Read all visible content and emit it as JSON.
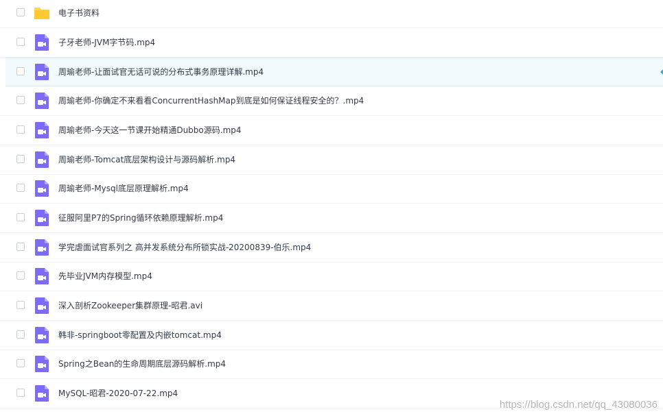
{
  "colors": {
    "folder": "#ffd45a",
    "video_icon": "#7b6cf3",
    "text": "#333a44",
    "highlight_bg": "#f2fafd"
  },
  "files": [
    {
      "name": "电子书资料",
      "icon": "folder-icon"
    },
    {
      "name": "子牙老师-JVM字节码.mp4",
      "icon": "video-file-icon"
    },
    {
      "name": "周瑜老师-让面试官无话可说的分布式事务原理详解.mp4",
      "icon": "video-file-icon",
      "highlighted": true
    },
    {
      "name": "周瑜老师-你确定不来看看ConcurrentHashMap到底是如何保证线程安全的？.mp4",
      "icon": "video-file-icon"
    },
    {
      "name": "周瑜老师-今天这一节课开始精通Dubbo源码.mp4",
      "icon": "video-file-icon"
    },
    {
      "name": "周瑜老师-Tomcat底层架构设计与源码解析.mp4",
      "icon": "video-file-icon"
    },
    {
      "name": "周瑜老师-Mysql底层原理解析.mp4",
      "icon": "video-file-icon"
    },
    {
      "name": "征服阿里P7的Spring循环依赖原理解析.mp4",
      "icon": "video-file-icon"
    },
    {
      "name": "学完虐面试官系列之 高并发系统分布所锁实战-20200839-伯乐.mp4",
      "icon": "video-file-icon"
    },
    {
      "name": "先毕业JVM内存模型.mp4",
      "icon": "video-file-icon"
    },
    {
      "name": "深入剖析Zookeeper集群原理-昭君.avi",
      "icon": "video-file-icon"
    },
    {
      "name": "韩非-springboot零配置及内嵌tomcat.mp4",
      "icon": "video-file-icon"
    },
    {
      "name": "Spring之Bean的生命周期底层源码解析.mp4",
      "icon": "video-file-icon"
    },
    {
      "name": "MySQL-昭君-2020-07-22.mp4",
      "icon": "video-file-icon"
    }
  ],
  "watermark": "https://blog.csdn.net/qq_43080036"
}
